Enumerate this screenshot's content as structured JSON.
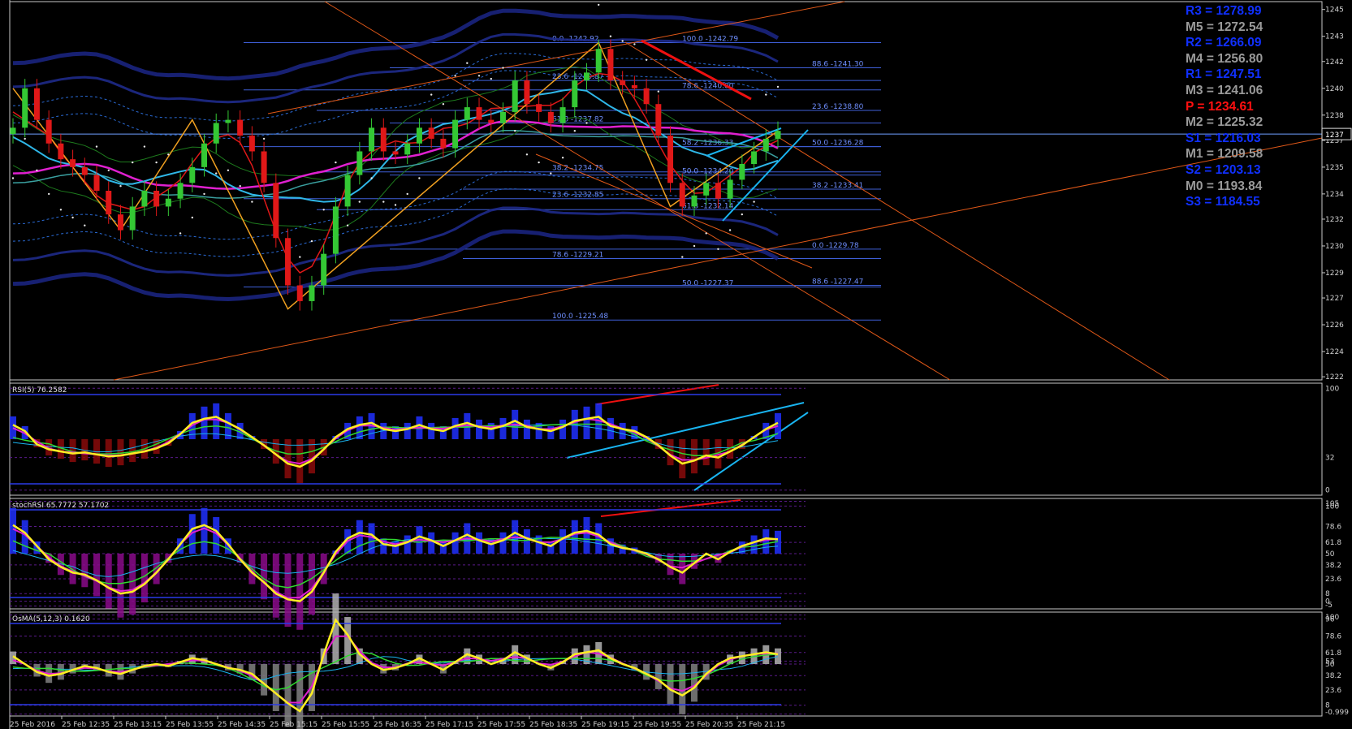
{
  "chart_data": {
    "type": "candlestick",
    "symbol_panel": {
      "ylim": [
        1221.5,
        1245.5
      ],
      "yticks": [
        "1245",
        "1243",
        "1242",
        "1240",
        "1238",
        "1237",
        "1235",
        "1234",
        "1232",
        "1230",
        "1229",
        "1227",
        "1226",
        "1224",
        "1222"
      ],
      "ytick_values": [
        1245,
        1243.3,
        1241.7,
        1240.0,
        1238.3,
        1236.7,
        1235.0,
        1233.3,
        1231.7,
        1230.0,
        1228.3,
        1226.7,
        1225.0,
        1223.3,
        1221.7
      ],
      "current_price_label": "1237",
      "current_price": 1237.1,
      "close_path": [
        1237.5,
        1240.0,
        1238.0,
        1236.5,
        1235.5,
        1235.0,
        1234.5,
        1233.5,
        1232.0,
        1231.0,
        1232.5,
        1233.5,
        1232.5,
        1233.0,
        1234.0,
        1235.0,
        1236.5,
        1237.8,
        1238.0,
        1237.0,
        1236.0,
        1234.0,
        1230.5,
        1227.5,
        1226.5,
        1227.5,
        1229.5,
        1232.5,
        1234.5,
        1236.0,
        1237.5,
        1236.0,
        1235.8,
        1236.5,
        1237.5,
        1236.8,
        1236.2,
        1238.0,
        1238.8,
        1238.0,
        1237.8,
        1238.5,
        1240.5,
        1239.0,
        1238.5,
        1237.8,
        1238.8,
        1240.5,
        1241.0,
        1242.5,
        1240.5,
        1240.2,
        1240.0,
        1239.0,
        1237.0,
        1234.0,
        1232.5,
        1233.2,
        1234.0,
        1233.0,
        1234.2,
        1235.2,
        1236.0,
        1236.8,
        1237.3
      ],
      "fib_levels": [
        {
          "label": "0.0 -1242.92",
          "value": 1242.9
        },
        {
          "label": "100.0 -1242.79",
          "value": 1242.9
        },
        {
          "label": "88.6 -1241.30",
          "value": 1241.3
        },
        {
          "label": "23.6 -1240.87",
          "value": 1240.5
        },
        {
          "label": "78.6 -1240.00",
          "value": 1239.9
        },
        {
          "label": "23.6 -1238.80",
          "value": 1238.6
        },
        {
          "label": "61.8 -1237.82",
          "value": 1237.8
        },
        {
          "label": "58.2 -1236.33",
          "value": 1236.3
        },
        {
          "label": "50.0 -1236.28",
          "value": 1236.3
        },
        {
          "label": "38.2 -1234.75",
          "value": 1234.7
        },
        {
          "label": "50.0 -1234.20",
          "value": 1234.5
        },
        {
          "label": "38.2 -1233.41",
          "value": 1233.6
        },
        {
          "label": "23.6 -1232.85",
          "value": 1233.0
        },
        {
          "label": "61.8 -1232.14",
          "value": 1232.3
        },
        {
          "label": "0.0 -1229.78",
          "value": 1229.8
        },
        {
          "label": "78.6 -1229.21",
          "value": 1229.2
        },
        {
          "label": "50.0 -1227.37",
          "value": 1227.4
        },
        {
          "label": "88.6 -1227.47",
          "value": 1227.5
        },
        {
          "label": "100.0 -1225.48",
          "value": 1225.3
        }
      ],
      "pivots": [
        {
          "label": "R3 = 1278.99",
          "color": "#1030ff"
        },
        {
          "label": "M5 = 1272.54",
          "color": "#9a9a9a"
        },
        {
          "label": "R2 = 1266.09",
          "color": "#1030ff"
        },
        {
          "label": "M4 = 1256.80",
          "color": "#9a9a9a"
        },
        {
          "label": "R1 = 1247.51",
          "color": "#1030ff"
        },
        {
          "label": "M3 = 1241.06",
          "color": "#9a9a9a"
        },
        {
          "label": "P   = 1234.61",
          "color": "#ff1010"
        },
        {
          "label": "M2 = 1225.32",
          "color": "#9a9a9a"
        },
        {
          "label": "S1 = 1216.03",
          "color": "#1030ff"
        },
        {
          "label": "M1 = 1209.58",
          "color": "#9a9a9a"
        },
        {
          "label": "S2 = 1203.13",
          "color": "#1030ff"
        },
        {
          "label": "M0 = 1193.84",
          "color": "#9a9a9a"
        },
        {
          "label": "S3 = 1184.55",
          "color": "#1030ff"
        }
      ]
    },
    "x_axis_labels": [
      "25 Feb 2016",
      "25 Feb 12:35",
      "25 Feb 13:15",
      "25 Feb 13:55",
      "25 Feb 14:35",
      "25 Feb 15:15",
      "25 Feb 15:55",
      "25 Feb 16:35",
      "25 Feb 17:15",
      "25 Feb 17:55",
      "25 Feb 18:35",
      "25 Feb 19:15",
      "25 Feb 19:55",
      "25 Feb 20:35",
      "25 Feb 21:15"
    ],
    "rsi_panel": {
      "title": "RSI(5) 76.2582",
      "yticks": [
        "100",
        "32",
        "0"
      ],
      "ytick_values": [
        100,
        32,
        0
      ],
      "ylim": [
        -5,
        105
      ],
      "values": [
        64,
        58,
        45,
        40,
        38,
        36,
        37,
        35,
        33,
        34,
        36,
        38,
        41,
        46,
        55,
        66,
        70,
        72,
        66,
        60,
        52,
        44,
        35,
        26,
        23,
        29,
        40,
        52,
        60,
        64,
        66,
        60,
        58,
        60,
        64,
        60,
        58,
        63,
        66,
        62,
        60,
        63,
        68,
        62,
        60,
        58,
        62,
        68,
        70,
        72,
        63,
        60,
        58,
        52,
        44,
        34,
        26,
        29,
        34,
        32,
        38,
        44,
        52,
        60,
        66
      ]
    },
    "stochrsi_panel": {
      "title": "stochRSI 65.7772 57.1702",
      "yticks": [
        "105",
        "100",
        "78.6",
        "61.8",
        "50",
        "38.2",
        "23.6",
        "8",
        "0",
        "-5"
      ],
      "ytick_values": [
        105,
        100,
        78.6,
        61.8,
        50,
        38.2,
        23.6,
        8,
        0,
        -5
      ],
      "ylim": [
        -8,
        108
      ],
      "values": [
        80,
        72,
        58,
        44,
        36,
        30,
        28,
        22,
        14,
        8,
        10,
        18,
        30,
        44,
        60,
        76,
        80,
        74,
        60,
        44,
        30,
        20,
        8,
        2,
        0,
        10,
        30,
        52,
        66,
        72,
        70,
        60,
        58,
        62,
        68,
        64,
        58,
        64,
        70,
        64,
        60,
        64,
        72,
        66,
        62,
        58,
        66,
        72,
        74,
        70,
        60,
        56,
        54,
        50,
        44,
        36,
        30,
        40,
        50,
        44,
        52,
        58,
        62,
        66,
        65
      ]
    },
    "osma_panel": {
      "title": "OsMA(5,12,3) 0.1620",
      "yticks": [
        "100",
        "96",
        "78.6",
        "61.8",
        "53",
        "50",
        "38.2",
        "23.6",
        "8",
        "-0.999"
      ],
      "ytick_values": [
        100,
        96,
        78.6,
        61.8,
        53,
        50,
        38.2,
        23.6,
        8,
        -0.999
      ],
      "ylim": [
        -3,
        103
      ],
      "values": [
        58,
        50,
        42,
        38,
        40,
        44,
        48,
        46,
        42,
        40,
        44,
        48,
        50,
        48,
        52,
        56,
        54,
        50,
        46,
        44,
        40,
        30,
        20,
        10,
        2,
        20,
        60,
        95,
        80,
        60,
        50,
        44,
        46,
        50,
        56,
        50,
        44,
        52,
        60,
        56,
        50,
        54,
        62,
        56,
        50,
        46,
        52,
        60,
        62,
        64,
        56,
        50,
        46,
        40,
        34,
        24,
        18,
        26,
        40,
        50,
        56,
        58,
        60,
        62,
        60
      ]
    }
  }
}
